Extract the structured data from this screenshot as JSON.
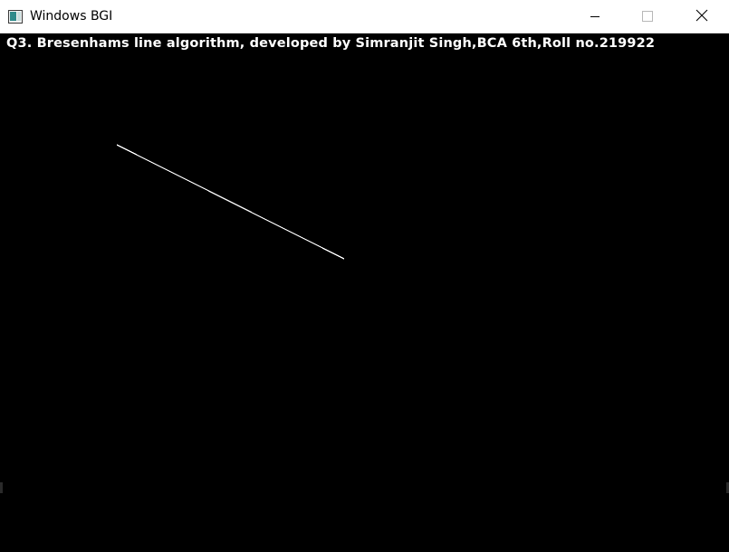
{
  "window": {
    "title": "Windows BGI",
    "icon": "application-window-icon",
    "controls": [
      "minimize-icon",
      "maximize-icon",
      "close-icon"
    ]
  },
  "canvas": {
    "background": "#000000",
    "header_text": "Q3. Bresenhams line algorithm, developed by Simranjit Singh,BCA 6th,Roll no.219922",
    "text_color": "#ffffff",
    "line_color": "#ffffff"
  }
}
